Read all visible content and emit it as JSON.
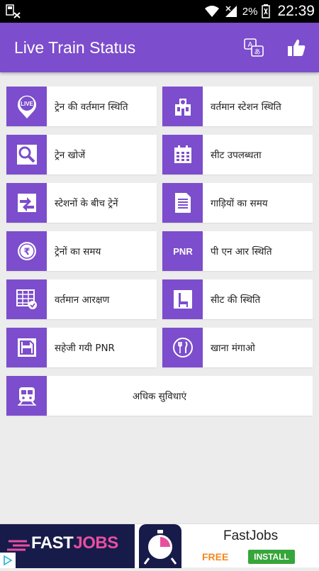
{
  "statusbar": {
    "battery_pct": "2%",
    "time": "22:39"
  },
  "appbar": {
    "title": "Live Train Status"
  },
  "menu": {
    "rows": [
      [
        {
          "label": "ट्रेन की वर्तमान स्थिति",
          "icon": "live-icon"
        },
        {
          "label": "वर्तमान स्टेशन स्थिति",
          "icon": "station-icon"
        }
      ],
      [
        {
          "label": "ट्रेन खोजें",
          "icon": "search-icon"
        },
        {
          "label": "सीट उपलब्धता",
          "icon": "calendar-icon"
        }
      ],
      [
        {
          "label": "स्टेशनों के बीच ट्रेनें",
          "icon": "swap-arrows-icon"
        },
        {
          "label": "गाड़ियों का समय",
          "icon": "document-icon"
        }
      ],
      [
        {
          "label": "ट्रेनों का समय",
          "icon": "rupee-icon"
        },
        {
          "label": "पी एन आर स्थिति",
          "icon": "pnr-icon"
        }
      ],
      [
        {
          "label": "वर्तमान आरक्षण",
          "icon": "table-check-icon"
        },
        {
          "label": "सीट की स्थिति",
          "icon": "seat-icon"
        }
      ],
      [
        {
          "label": "सहेजी गयी PNR",
          "icon": "save-icon"
        },
        {
          "label": "खाना मंगाओ",
          "icon": "food-icon"
        }
      ]
    ],
    "more": {
      "label": "अधिक सुविधाएं",
      "icon": "train-icon"
    }
  },
  "ad": {
    "brand_a": "FAST",
    "brand_b": "JOBS",
    "name": "FastJobs",
    "free": "FREE",
    "install": "INSTALL"
  },
  "colors": {
    "primary": "#7c4dcc",
    "background": "#ececec",
    "ad_brand": "#171b4a",
    "install": "#36a53a",
    "free": "#f28a1e"
  }
}
